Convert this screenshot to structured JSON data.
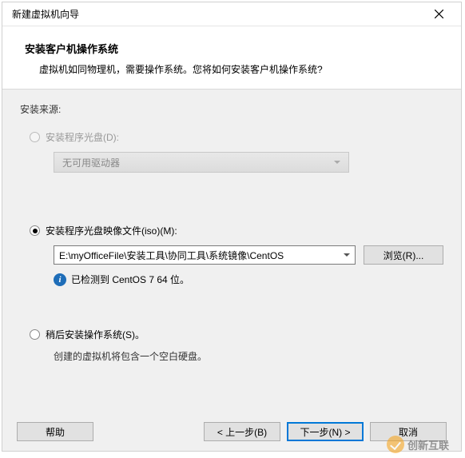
{
  "window": {
    "title": "新建虚拟机向导"
  },
  "header": {
    "title": "安装客户机操作系统",
    "description": "虚拟机如同物理机，需要操作系统。您将如何安装客户机操作系统?"
  },
  "source": {
    "label": "安装来源:",
    "options": {
      "disc": {
        "label": "安装程序光盘(D):",
        "selected": false,
        "disabled": true,
        "dropdown_text": "无可用驱动器"
      },
      "iso": {
        "label": "安装程序光盘映像文件(iso)(M):",
        "selected": true,
        "path": "E:\\myOfficeFile\\安装工具\\协同工具\\系统镜像\\CentOS",
        "browse_label": "浏览(R)...",
        "info_text": "已检测到 CentOS 7 64 位。"
      },
      "later": {
        "label": "稍后安装操作系统(S)。",
        "selected": false,
        "note": "创建的虚拟机将包含一个空白硬盘。"
      }
    }
  },
  "footer": {
    "help": "帮助",
    "back": "< 上一步(B)",
    "next": "下一步(N) >",
    "cancel": "取消"
  },
  "watermark": {
    "text": "创新互联"
  }
}
